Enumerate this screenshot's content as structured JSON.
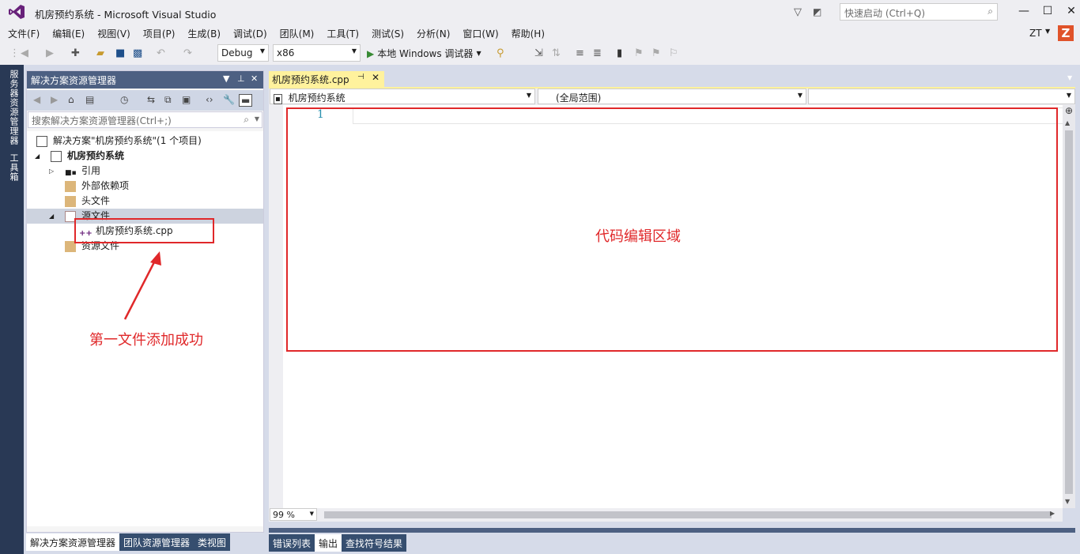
{
  "window": {
    "title": "机房预约系统 - Microsoft Visual Studio",
    "quick_launch_placeholder": "快速启动 (Ctrl+Q)",
    "user": "ZT",
    "badge": "Z"
  },
  "menu": [
    "文件(F)",
    "编辑(E)",
    "视图(V)",
    "项目(P)",
    "生成(B)",
    "调试(D)",
    "团队(M)",
    "工具(T)",
    "测试(S)",
    "分析(N)",
    "窗口(W)",
    "帮助(H)"
  ],
  "toolbar": {
    "config": "Debug",
    "platform": "x86",
    "run_label": "本地 Windows 调试器"
  },
  "side_tabs": [
    "服务器资源管理器",
    "工具箱"
  ],
  "solution_explorer": {
    "title": "解决方案资源管理器",
    "search_placeholder": "搜索解决方案资源管理器(Ctrl+;)",
    "tree": [
      {
        "label": "解决方案\"机房预约系统\"(1 个项目)",
        "level": 0,
        "expand": "",
        "icon": "solution-icon"
      },
      {
        "label": "机房预约系统",
        "level": 0,
        "expand": "▲",
        "icon": "project-icon",
        "bold": true
      },
      {
        "label": "引用",
        "level": 1,
        "expand": "▷",
        "icon": "references-icon"
      },
      {
        "label": "外部依赖项",
        "level": 1,
        "expand": "",
        "icon": "folder-icon"
      },
      {
        "label": "头文件",
        "level": 1,
        "expand": "",
        "icon": "folder-icon"
      },
      {
        "label": "源文件",
        "level": 1,
        "expand": "▲",
        "icon": "folder-open-icon",
        "selected": true
      },
      {
        "label": "机房预约系统.cpp",
        "level": 2,
        "expand": "",
        "icon": "cpp-file-icon"
      },
      {
        "label": "资源文件",
        "level": 1,
        "expand": "",
        "icon": "folder-icon"
      }
    ],
    "bottom_tabs": [
      "解决方案资源管理器",
      "团队资源管理器",
      "类视图"
    ]
  },
  "editor": {
    "tab": "机房预约系统.cpp",
    "nav_project": "机房预约系统",
    "nav_scope": "(全局范围)",
    "nav_member": "",
    "line_number": "1",
    "zoom": "99 %",
    "annotation": "代码编辑区域"
  },
  "bottom_tabs": [
    "错误列表",
    "输出",
    "查找符号结果"
  ],
  "annotation_left": "第一文件添加成功",
  "colors": {
    "accent": "#4d6082",
    "tab_active": "#fff29d",
    "annotation": "#e0282a"
  }
}
